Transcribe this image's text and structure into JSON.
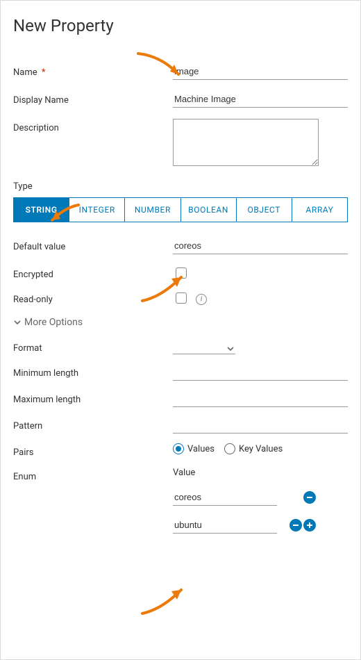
{
  "title": "New Property",
  "labels": {
    "name": "Name",
    "displayName": "Display Name",
    "description": "Description",
    "type": "Type",
    "defaultValue": "Default value",
    "encrypted": "Encrypted",
    "readOnly": "Read-only",
    "moreOptions": "More Options",
    "format": "Format",
    "minLength": "Minimum length",
    "maxLength": "Maximum length",
    "pattern": "Pattern",
    "pairs": "Pairs",
    "enum": "Enum",
    "enumValueHeader": "Value"
  },
  "values": {
    "name": "image",
    "displayName": "Machine Image",
    "description": "",
    "defaultValue": "coreos",
    "encrypted": false,
    "readOnly": false,
    "format": "",
    "minLength": "",
    "maxLength": "",
    "pattern": "",
    "pairsSelection": "values"
  },
  "typeTabs": [
    {
      "id": "string",
      "label": "STRING",
      "active": true
    },
    {
      "id": "integer",
      "label": "INTEGER",
      "active": false
    },
    {
      "id": "number",
      "label": "NUMBER",
      "active": false
    },
    {
      "id": "boolean",
      "label": "BOOLEAN",
      "active": false
    },
    {
      "id": "object",
      "label": "OBJECT",
      "active": false
    },
    {
      "id": "array",
      "label": "ARRAY",
      "active": false
    }
  ],
  "pairsOptions": {
    "values": "Values",
    "keyValues": "Key Values"
  },
  "enumItems": [
    {
      "value": "coreos",
      "canRemove": true,
      "canAdd": false
    },
    {
      "value": "ubuntu",
      "canRemove": true,
      "canAdd": true
    }
  ]
}
